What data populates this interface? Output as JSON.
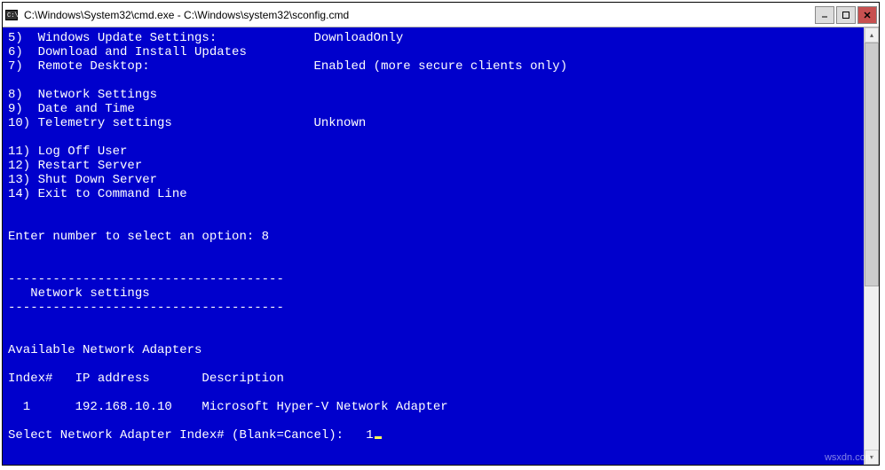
{
  "window": {
    "title": "C:\\Windows\\System32\\cmd.exe - C:\\Windows\\system32\\sconfig.cmd"
  },
  "menu": {
    "items": [
      {
        "num": "5)",
        "label": "Windows Update Settings:",
        "value": "DownloadOnly"
      },
      {
        "num": "6)",
        "label": "Download and Install Updates",
        "value": ""
      },
      {
        "num": "7)",
        "label": "Remote Desktop:",
        "value": "Enabled (more secure clients only)"
      },
      {
        "num": "",
        "label": "",
        "value": ""
      },
      {
        "num": "8)",
        "label": "Network Settings",
        "value": ""
      },
      {
        "num": "9)",
        "label": "Date and Time",
        "value": ""
      },
      {
        "num": "10)",
        "label": "Telemetry settings",
        "value": "Unknown"
      },
      {
        "num": "",
        "label": "",
        "value": ""
      },
      {
        "num": "11)",
        "label": "Log Off User",
        "value": ""
      },
      {
        "num": "12)",
        "label": "Restart Server",
        "value": ""
      },
      {
        "num": "13)",
        "label": "Shut Down Server",
        "value": ""
      },
      {
        "num": "14)",
        "label": "Exit to Command Line",
        "value": ""
      }
    ]
  },
  "prompt1": {
    "label": "Enter number to select an option:",
    "value": "8"
  },
  "section": {
    "title": "Network settings",
    "divider": "-------------------------------------"
  },
  "adapters": {
    "heading": "Available Network Adapters",
    "columns": {
      "c1": "Index#",
      "c2": "IP address",
      "c3": "Description"
    },
    "rows": [
      {
        "index": "1",
        "ip": "192.168.10.10",
        "desc": "Microsoft Hyper-V Network Adapter"
      }
    ]
  },
  "prompt2": {
    "label": "Select Network Adapter Index# (Blank=Cancel):",
    "value": "1"
  },
  "watermark": "wsxdn.com"
}
